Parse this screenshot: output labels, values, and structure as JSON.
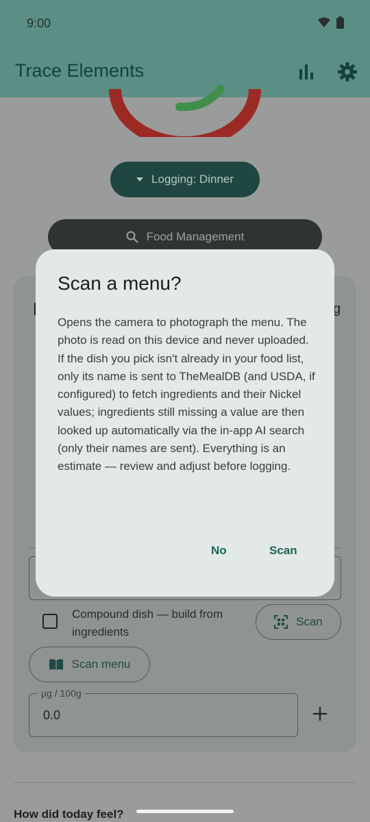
{
  "status_bar": {
    "time": "9:00",
    "icons": [
      "wifi-icon",
      "battery-icon"
    ]
  },
  "app_bar": {
    "title": "Trace Elements",
    "actions": [
      "bar-chart-icon",
      "gear-icon"
    ]
  },
  "logging": {
    "label": "Logging: Dinner"
  },
  "food_management": {
    "label": "Food Management"
  },
  "card": {
    "trailing_text": "g",
    "compound_dish_label": "Compound dish — build from ingredients",
    "scan_label": "Scan",
    "scan_menu_label": "Scan menu",
    "ug_label": "µg / 100g",
    "ug_value": "0.0"
  },
  "footer": {
    "feel_label": "How did today feel?"
  },
  "dialog": {
    "title": "Scan a menu?",
    "body": "Opens the camera to photograph the menu. The photo is read on this device and never uploaded. If the dish you pick isn't already in your food list, only its name is sent to TheMealDB (and USDA, if configured) to fetch ingredients and their Nickel values; ingredients still missing a value are then looked up automatically via the in-app AI search (only their names are sent). Everything is an estimate — review and adjust before logging.",
    "no_label": "No",
    "scan_label": "Scan"
  },
  "colors": {
    "accent": "#1b6456",
    "gauge_red": "#9c2a24",
    "gauge_green": "#3f8f4a"
  }
}
